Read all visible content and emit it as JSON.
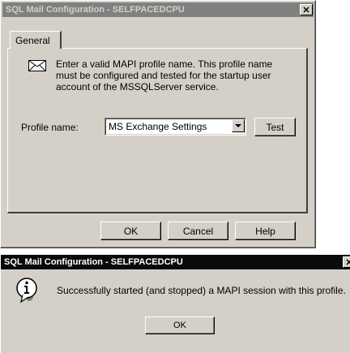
{
  "config_dialog": {
    "title": "SQL Mail Configuration - SELFPACEDCPU",
    "close_glyph": "✕",
    "tab_general": "General",
    "info_icon": "envelope-icon",
    "info_text": "Enter a valid MAPI profile name.  This profile name must be configured and tested for the startup user account of the MSSQLServer service.",
    "profile_label": "Profile name:",
    "profile_value": "MS Exchange Settings",
    "test_button": "Test",
    "ok_button": "OK",
    "cancel_button": "Cancel",
    "help_button": "Help"
  },
  "message_box": {
    "title": "SQL Mail Configuration - SELFPACEDCPU",
    "close_glyph": "✕",
    "icon": "information-icon",
    "message": "Successfully started (and stopped) a MAPI session with this profile.",
    "ok_button": "OK"
  },
  "colors": {
    "dialog_face": "#d4d0c8",
    "inactive_title": "#808080",
    "active_title": "#0a0a0a"
  }
}
